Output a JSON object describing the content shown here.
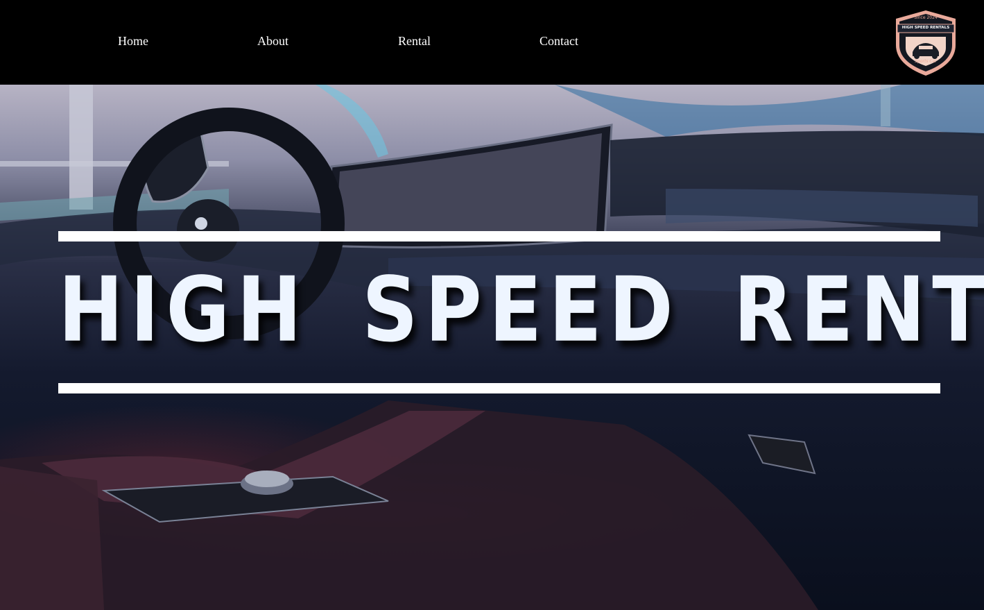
{
  "nav": {
    "items": [
      {
        "label": "Home"
      },
      {
        "label": "About"
      },
      {
        "label": "Rental"
      },
      {
        "label": "Contact"
      }
    ]
  },
  "logo": {
    "top_text": "Since 2024",
    "brand_text": "HIGH SPEED RENTALS",
    "bottom_text": "Sports Car",
    "colors": {
      "outer": "#e9a99a",
      "inner": "#141821",
      "ribbon": "#1d2230",
      "center": "#f2d4c8"
    }
  },
  "hero": {
    "title": "HIGH  SPEED  RENTALS",
    "image": "car-interior-dashboard"
  },
  "colors": {
    "nav_bg": "#000000",
    "nav_text": "#ffffff",
    "title_text": "#eef5ff"
  }
}
